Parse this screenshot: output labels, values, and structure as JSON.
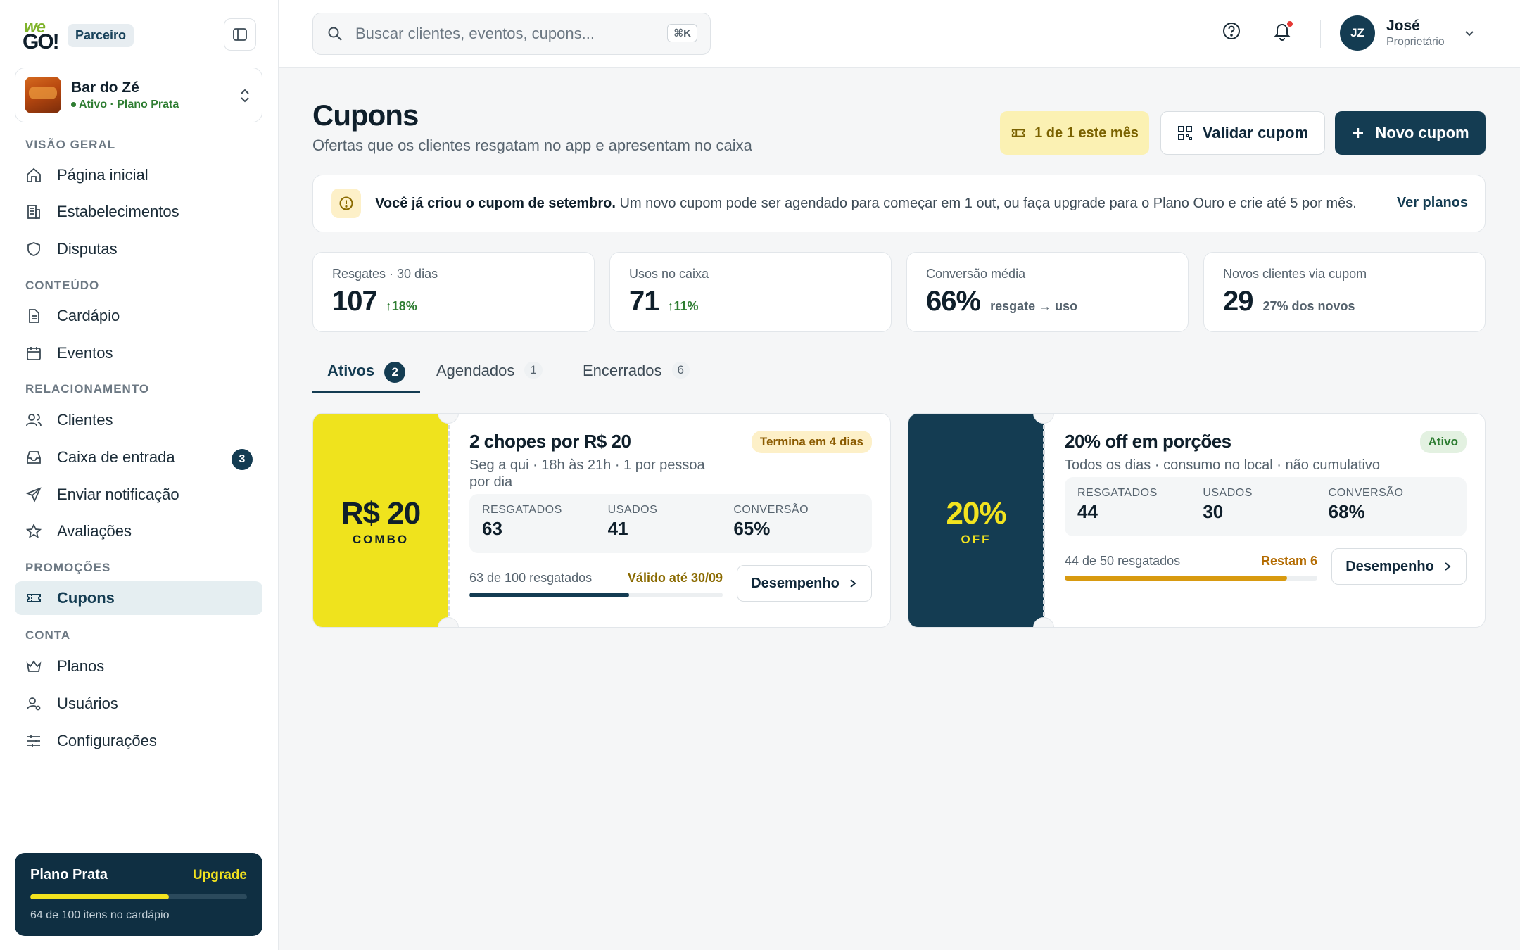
{
  "brand": {
    "logo_top": "we",
    "logo_bottom": "GO!",
    "partner_label": "Parceiro"
  },
  "venue": {
    "name": "Bar do Zé",
    "status": "Ativo · Plano Prata"
  },
  "nav": {
    "sections": [
      "VISÃO GERAL",
      "CONTEÚDO",
      "RELACIONAMENTO",
      "PROMOÇÕES",
      "CONTA"
    ],
    "items": [
      {
        "label": "Página inicial",
        "icon": "home-icon"
      },
      {
        "label": "Estabelecimentos",
        "icon": "building-icon"
      },
      {
        "label": "Disputas",
        "icon": "shield-icon"
      },
      {
        "label": "Cardápio",
        "icon": "document-icon"
      },
      {
        "label": "Eventos",
        "icon": "calendar-icon"
      },
      {
        "label": "Clientes",
        "icon": "users-icon"
      },
      {
        "label": "Caixa de entrada",
        "icon": "inbox-icon",
        "badge": "3"
      },
      {
        "label": "Enviar notificação",
        "icon": "send-icon"
      },
      {
        "label": "Avaliações",
        "icon": "star-icon"
      },
      {
        "label": "Cupons",
        "icon": "ticket-icon",
        "active": true
      },
      {
        "label": "Planos",
        "icon": "crown-icon"
      },
      {
        "label": "Usuários",
        "icon": "user-gear-icon"
      },
      {
        "label": "Configurações",
        "icon": "sliders-icon"
      }
    ]
  },
  "plan_card": {
    "name": "Plano Prata",
    "upgrade": "Upgrade",
    "caption": "64 de 100 itens no cardápio",
    "progress": 0.64
  },
  "topbar": {
    "search_placeholder": "Buscar clientes, eventos, cupons...",
    "shortcut": "⌘K",
    "user_initials": "JZ",
    "user_name": "José",
    "user_role": "Proprietário"
  },
  "header": {
    "title": "Cupons",
    "subtitle": "Ofertas que os clientes resgatam no app e apresentam no caixa",
    "quota": "1 de 1 este mês",
    "validate_label": "Validar cupom",
    "new_label": "Novo cupom"
  },
  "banner": {
    "strong": "Você já criou o cupom de setembro.",
    "text": " Um novo cupom pode ser agendado para começar em 1 out, ou faça upgrade para o Plano Ouro e crie até 5 por mês.",
    "link": "Ver planos"
  },
  "stats": [
    {
      "label": "Resgates · 30 dias",
      "value": "107",
      "delta": "18%"
    },
    {
      "label": "Usos no caixa",
      "value": "71",
      "delta": "11%"
    },
    {
      "label": "Conversão média",
      "value": "66%",
      "note": "resgate → uso"
    },
    {
      "label": "Novos clientes via cupom",
      "value": "29",
      "note": "27% dos novos"
    }
  ],
  "tabs": [
    {
      "label": "Ativos",
      "count": "2",
      "active": true
    },
    {
      "label": "Agendados",
      "count": "1"
    },
    {
      "label": "Encerrados",
      "count": "6"
    }
  ],
  "coupons": [
    {
      "stub_big": "R$ 20",
      "stub_small": "COMBO",
      "stub_color": "#efe31d",
      "stub_text_color": "#0f1f2b",
      "title": "2 chopes por R$ 20",
      "subtitle": "Seg a qui · 18h às 21h · 1 por pessoa por dia",
      "pill": "Termina em 4 dias",
      "metrics": [
        {
          "label": "RESGATADOS",
          "value": "63"
        },
        {
          "label": "USADOS",
          "value": "41"
        },
        {
          "label": "CONVERSÃO",
          "value": "65%"
        }
      ],
      "progress_text": "63 de 100 resgatados",
      "progress_right": "Válido até 30/09",
      "progress": 0.63,
      "button": "Desempenho"
    },
    {
      "stub_big": "20%",
      "stub_small": "OFF",
      "stub_color": "#143c52",
      "stub_text_color": "#f2e31f",
      "title": "20% off em porções",
      "subtitle": "Todos os dias · consumo no local · não cumulativo",
      "pill": "Ativo",
      "metrics": [
        {
          "label": "RESGATADOS",
          "value": "44"
        },
        {
          "label": "USADOS",
          "value": "30"
        },
        {
          "label": "CONVERSÃO",
          "value": "68%"
        }
      ],
      "progress_text": "44 de 50 resgatados",
      "progress_right": "Restam 6",
      "progress": 0.88,
      "button": "Desempenho"
    }
  ]
}
